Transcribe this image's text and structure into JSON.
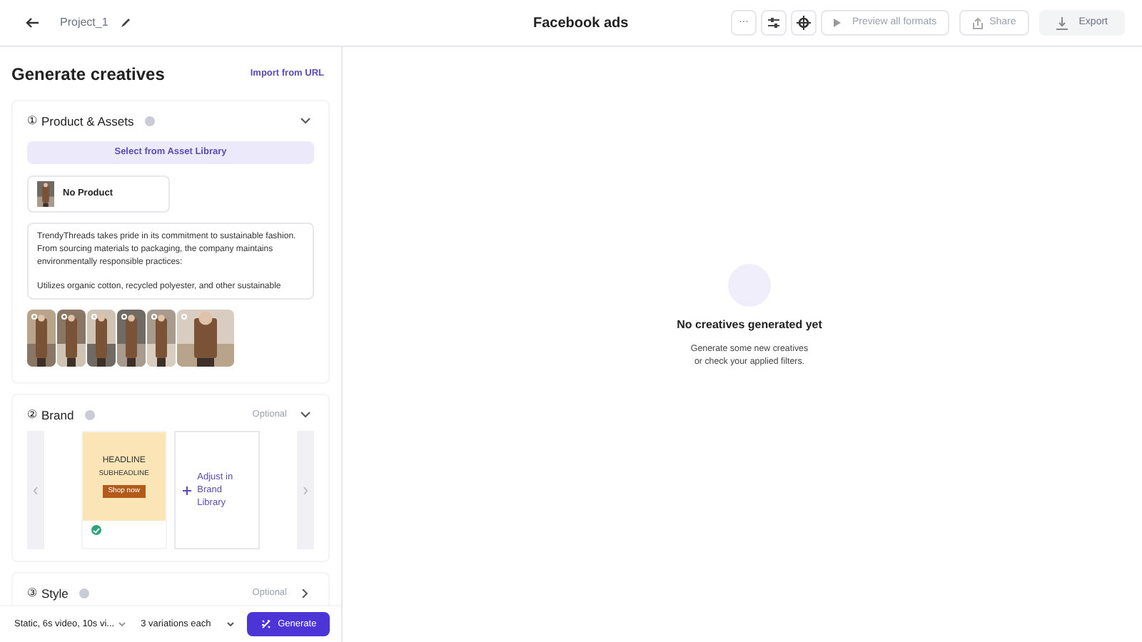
{
  "header": {
    "project": "Project_1",
    "title": "Facebook ads",
    "toolbar": [
      {
        "kind": "more",
        "label": "···"
      },
      {
        "kind": "sliders"
      },
      {
        "kind": "target"
      },
      {
        "kind": "preview",
        "label": "Preview all formats"
      },
      {
        "kind": "share",
        "label": "Share"
      },
      {
        "kind": "export",
        "label": "Export"
      }
    ]
  },
  "panel": {
    "title": "Generate creatives",
    "import_link": "Import from URL",
    "sections": [
      {
        "kind": "product",
        "number": "①",
        "title": "Product & Assets",
        "expanded": true,
        "library_button": "Select from Asset Library",
        "product": "No Product",
        "description": [
          "TrendyThreads takes pride in its commitment to sustainable fashion. From sourcing materials to packaging, the company maintains environmentally responsible practices:",
          "Utilizes organic cotton, recycled polyester, and other sustainable"
        ],
        "images": [
          {
            "kind": "picture",
            "selected": false
          },
          {
            "kind": "picture",
            "selected": false
          },
          {
            "kind": "picture",
            "selected": false
          },
          {
            "kind": "picture",
            "selected": false
          },
          {
            "kind": "picture",
            "selected": false
          },
          {
            "kind": "picture",
            "selected": false
          }
        ]
      },
      {
        "kind": "brand",
        "number": "②",
        "title": "Brand",
        "optional": "Optional",
        "expanded": true,
        "preview": {
          "headline": "HEADLINE",
          "subheadline": "SUBHEADLINE",
          "cta": "Shop now",
          "checked": true
        },
        "adjust": "Adjust in Brand Library"
      },
      {
        "kind": "style",
        "number": "③",
        "title": "Style",
        "optional": "Optional",
        "expanded": false
      }
    ]
  },
  "footer": {
    "formats": "Static, 6s video, 10s vi...",
    "variations": "3 variations each",
    "generate": "Generate"
  },
  "empty_state": {
    "title": "No creatives generated yet",
    "lines": [
      "Generate some new creatives",
      "or check your applied filters."
    ]
  }
}
